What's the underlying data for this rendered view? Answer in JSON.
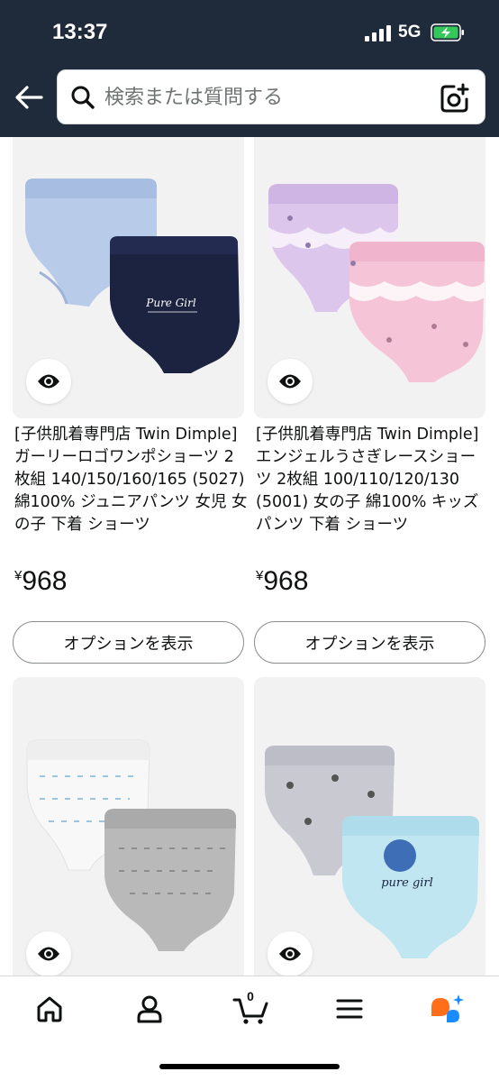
{
  "status_bar": {
    "time": "13:37",
    "network": "5G"
  },
  "search": {
    "placeholder": "検索または質問する"
  },
  "products": [
    {
      "title": "[子供肌着専門店 Twin Dimple] ガーリーロゴワンポショーツ 2枚組 140/150/160/165 (5027) 綿100% ジュニアパンツ 女児 女の子 下着 ショーツ",
      "currency": "¥",
      "price": "968",
      "option_label": "オプションを表示",
      "image_text": "Pure Girl"
    },
    {
      "title": "[子供肌着専門店 Twin Dimple] エンジェルうさぎレースショーツ 2枚組 100/110/120/130 (5001) 女の子 綿100% キッズパンツ 下着 ショーツ",
      "currency": "¥",
      "price": "968",
      "option_label": "オプションを表示"
    },
    {
      "title": "",
      "price": ""
    },
    {
      "title": "",
      "price": "",
      "image_text": "pure girl"
    }
  ],
  "bottom_nav": {
    "cart_count": "0"
  },
  "colors": {
    "header_bg": "#1f2b3a",
    "card_bg": "#f2f2f2",
    "battery_green": "#34c759",
    "ai_orange": "#ff6f1a",
    "ai_blue": "#1a8cff"
  }
}
